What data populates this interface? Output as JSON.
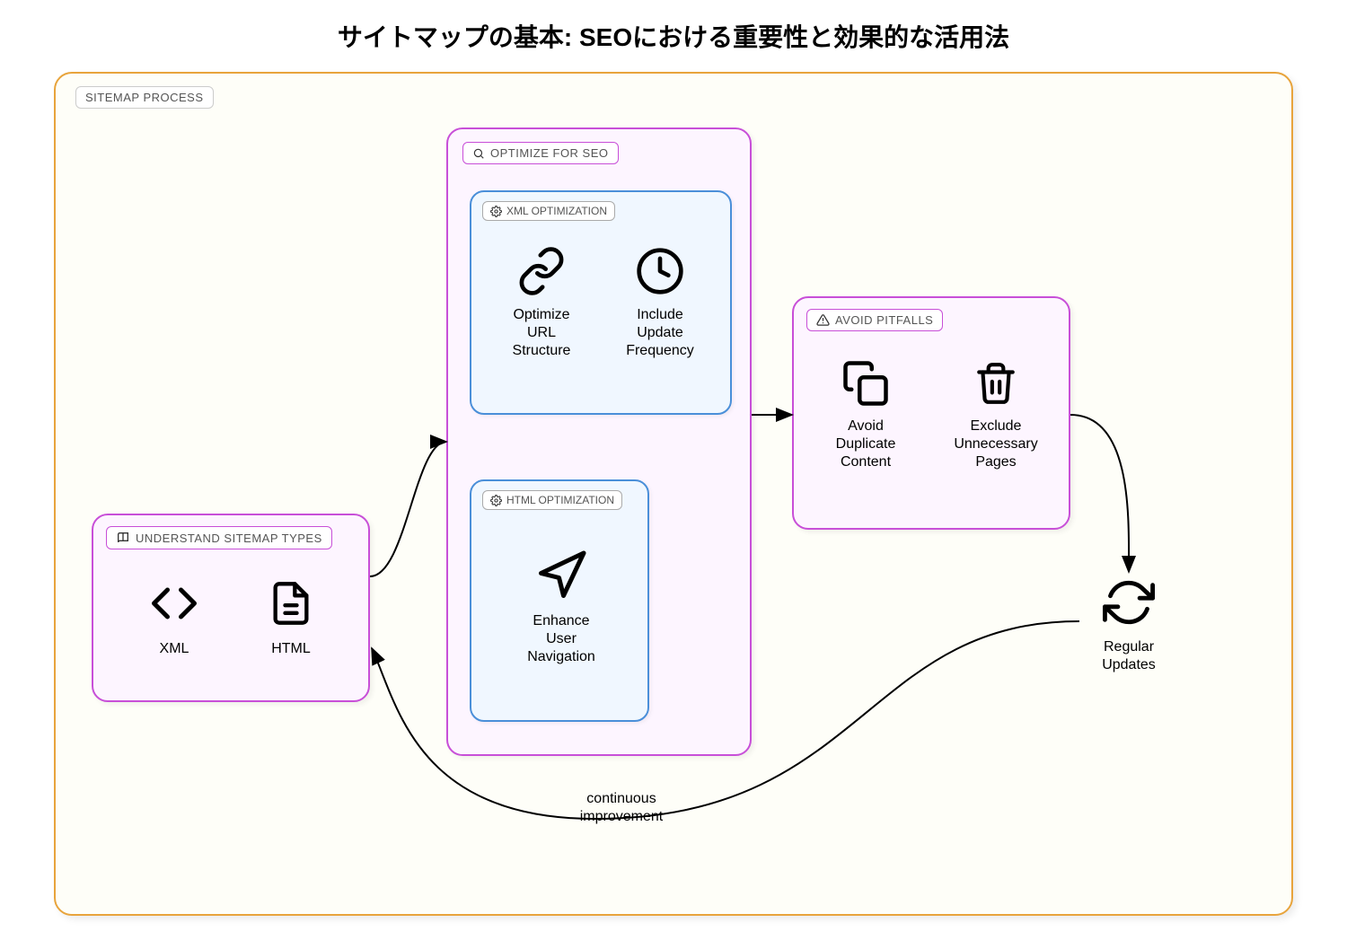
{
  "title": "サイトマップの基本: SEOにおける重要性と効果的な活用法",
  "outer_label": "SITEMAP PROCESS",
  "groups": {
    "understand": {
      "label": "UNDERSTAND SITEMAP TYPES",
      "xml": "XML",
      "html": "HTML"
    },
    "optimize": {
      "label": "OPTIMIZE FOR SEO",
      "xml_opt": {
        "label": "XML OPTIMIZATION",
        "url": "Optimize\nURL\nStructure",
        "freq": "Include\nUpdate\nFrequency"
      },
      "html_opt": {
        "label": "HTML OPTIMIZATION",
        "nav": "Enhance\nUser\nNavigation"
      }
    },
    "pitfalls": {
      "label": "AVOID PITFALLS",
      "dup": "Avoid\nDuplicate\nContent",
      "excl": "Exclude\nUnnecessary\nPages"
    }
  },
  "regular_updates": "Regular\nUpdates",
  "loop_label": "continuous\nimprovement"
}
